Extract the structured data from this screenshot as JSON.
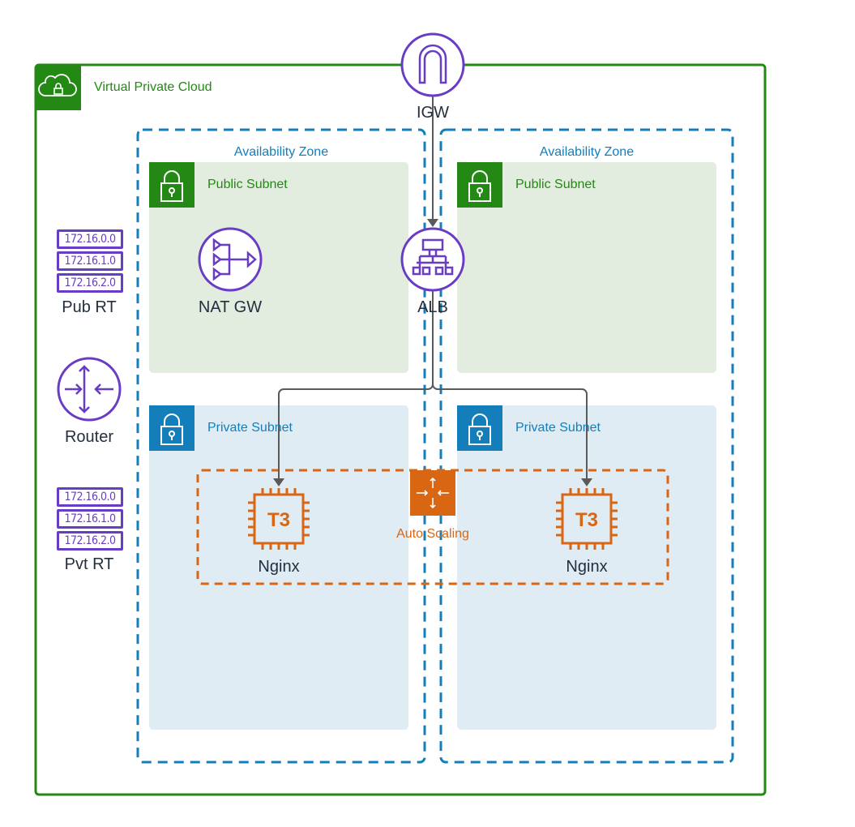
{
  "colors": {
    "vpc": "#248814",
    "az": "#147EBA",
    "public_subnet_fill": "#E2EDDF",
    "private_subnet_fill": "#DFECF4",
    "service_purple": "#693CC5",
    "compute_orange": "#D86613",
    "connector": "#5a5a5a"
  },
  "vpc": {
    "label": "Virtual Private Cloud",
    "icon": "cloud-lock-icon"
  },
  "zones": [
    {
      "label": "Availability Zone",
      "public_subnet": "Public Subnet",
      "private_subnet": "Private Subnet"
    },
    {
      "label": "Availability Zone",
      "public_subnet": "Public Subnet",
      "private_subnet": "Private Subnet"
    }
  ],
  "nodes": {
    "igw": {
      "label": "IGW",
      "icon": "internet-gateway-icon"
    },
    "alb": {
      "label": "ALB",
      "icon": "load-balancer-icon"
    },
    "nat": {
      "label": "NAT GW",
      "icon": "nat-gateway-icon"
    },
    "router": {
      "label": "Router",
      "icon": "router-icon"
    },
    "asg": {
      "label": "Auto Scaling",
      "icon": "auto-scaling-icon"
    },
    "instances": [
      {
        "label": "Nginx",
        "chip": "T3"
      },
      {
        "label": "Nginx",
        "chip": "T3"
      }
    ]
  },
  "route_tables": [
    {
      "label": "Pub RT",
      "routes": [
        "172.16.0.0",
        "172.16.1.0",
        "172.16.2.0"
      ]
    },
    {
      "label": "Pvt RT",
      "routes": [
        "172.16.0.0",
        "172.16.1.0",
        "172.16.2.0"
      ]
    }
  ],
  "connections": [
    [
      "IGW",
      "ALB"
    ],
    [
      "ALB",
      "Nginx"
    ],
    [
      "ALB",
      "Nginx"
    ]
  ]
}
